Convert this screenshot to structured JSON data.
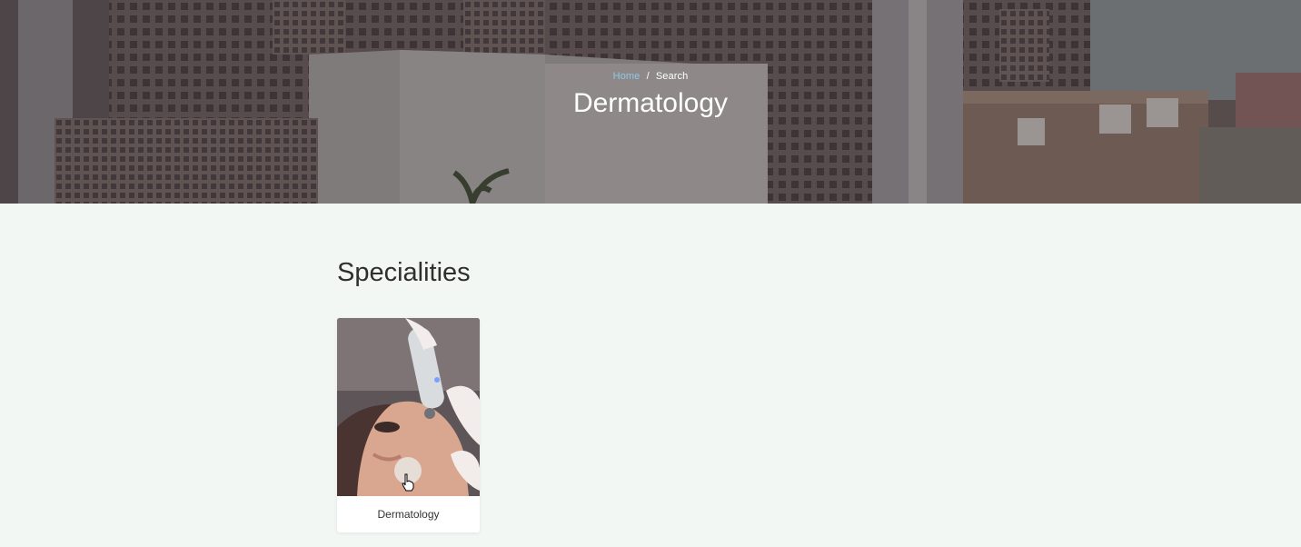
{
  "hero": {
    "breadcrumb": {
      "home": "Home",
      "separator": "/",
      "current": "Search"
    },
    "title": "Dermatology"
  },
  "specialities": {
    "heading": "Specialities",
    "cards": [
      {
        "label": "Dermatology",
        "image": "dermatology-treatment-photo"
      }
    ]
  },
  "colors": {
    "page_background": "#f3f7f4",
    "breadcrumb_link": "#8fc8e8",
    "heading_text": "#2f2f2f"
  }
}
